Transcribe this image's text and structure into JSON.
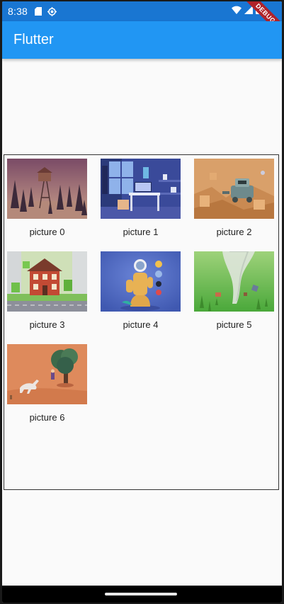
{
  "status_bar": {
    "time": "8:38",
    "icons": [
      "sd-card-icon",
      "gps-icon",
      "wifi-icon",
      "signal-icon",
      "battery-icon"
    ],
    "debug_label": "DEBUG"
  },
  "app_bar": {
    "title": "Flutter",
    "color": "#2196f3"
  },
  "grid": {
    "items": [
      {
        "caption": "picture 0"
      },
      {
        "caption": "picture 1"
      },
      {
        "caption": "picture 2"
      },
      {
        "caption": "picture 3"
      },
      {
        "caption": "picture 4"
      },
      {
        "caption": "picture 5"
      },
      {
        "caption": "picture 6"
      }
    ]
  }
}
